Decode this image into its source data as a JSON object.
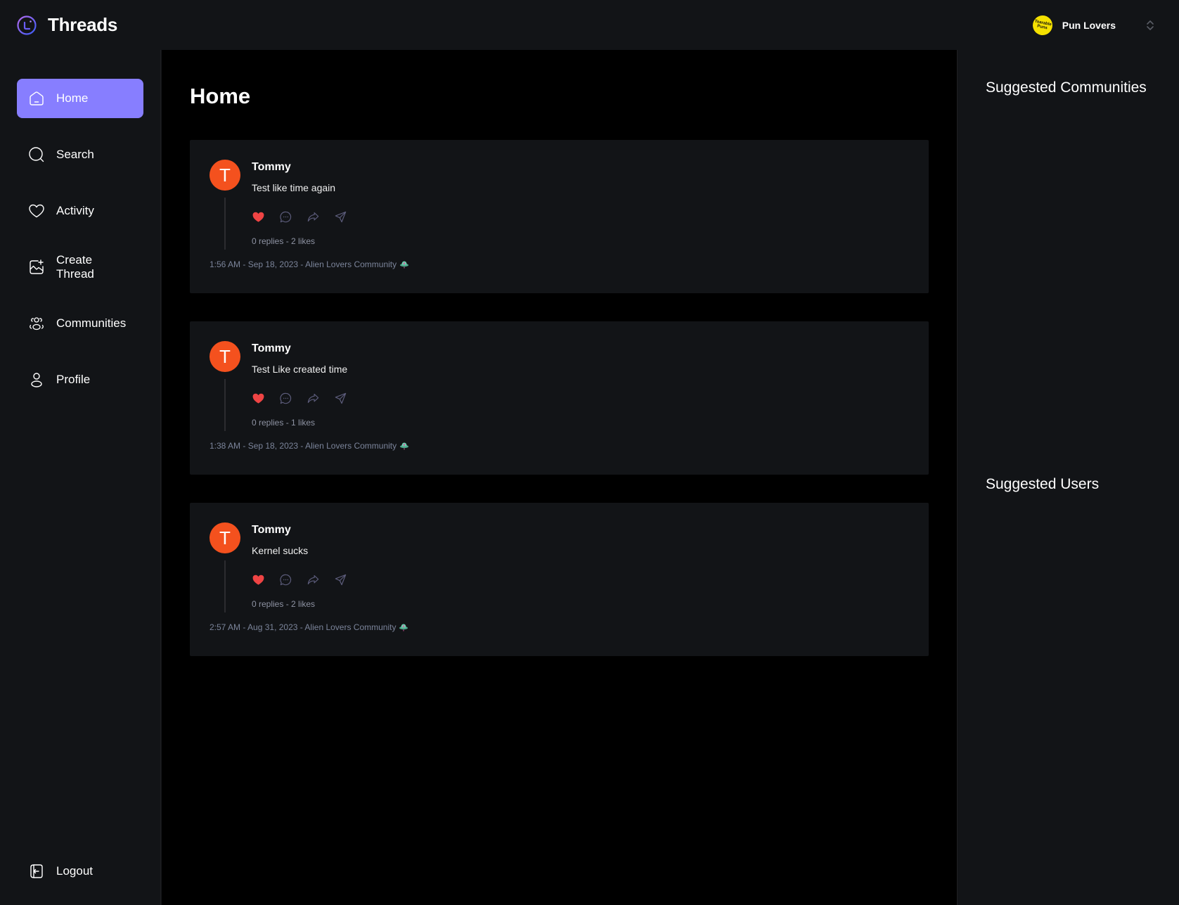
{
  "app": {
    "title": "Threads"
  },
  "org_switcher": {
    "name": "Pun Lovers",
    "avatar_text": "Tearable Puns",
    "avatar_color": "#f5e100"
  },
  "sidebar": {
    "items": [
      {
        "label": "Home",
        "icon": "home-icon",
        "active": true
      },
      {
        "label": "Search",
        "icon": "search-icon",
        "active": false
      },
      {
        "label": "Activity",
        "icon": "heart-icon",
        "active": false
      },
      {
        "label": "Create Thread",
        "icon": "create-image-icon",
        "active": false
      },
      {
        "label": "Communities",
        "icon": "community-icon",
        "active": false
      },
      {
        "label": "Profile",
        "icon": "user-icon",
        "active": false
      }
    ],
    "logout_label": "Logout",
    "active_color": "#877eff"
  },
  "main": {
    "title": "Home",
    "threads": [
      {
        "author": "Tommy",
        "avatar_letter": "T",
        "text": "Test like time again",
        "counts": "0 replies - 2 likes",
        "footer": "1:56 AM - Sep 18, 2023 - Alien Lovers Community",
        "community_icon": "ufo-icon",
        "liked": true
      },
      {
        "author": "Tommy",
        "avatar_letter": "T",
        "text": "Test Like created time",
        "counts": "0 replies - 1 likes",
        "footer": "1:38 AM - Sep 18, 2023 - Alien Lovers Community",
        "community_icon": "ufo-icon",
        "liked": true
      },
      {
        "author": "Tommy",
        "avatar_letter": "T",
        "text": "Kernel sucks",
        "counts": "0 replies - 2 likes",
        "footer": "2:57 AM - Aug 31, 2023 - Alien Lovers Community",
        "community_icon": "ufo-icon",
        "liked": true
      }
    ],
    "avatar_color": "#f4511e",
    "like_color": "#ef4444"
  },
  "rightbar": {
    "suggested_communities_title": "Suggested Communities",
    "suggested_users_title": "Suggested Users"
  }
}
